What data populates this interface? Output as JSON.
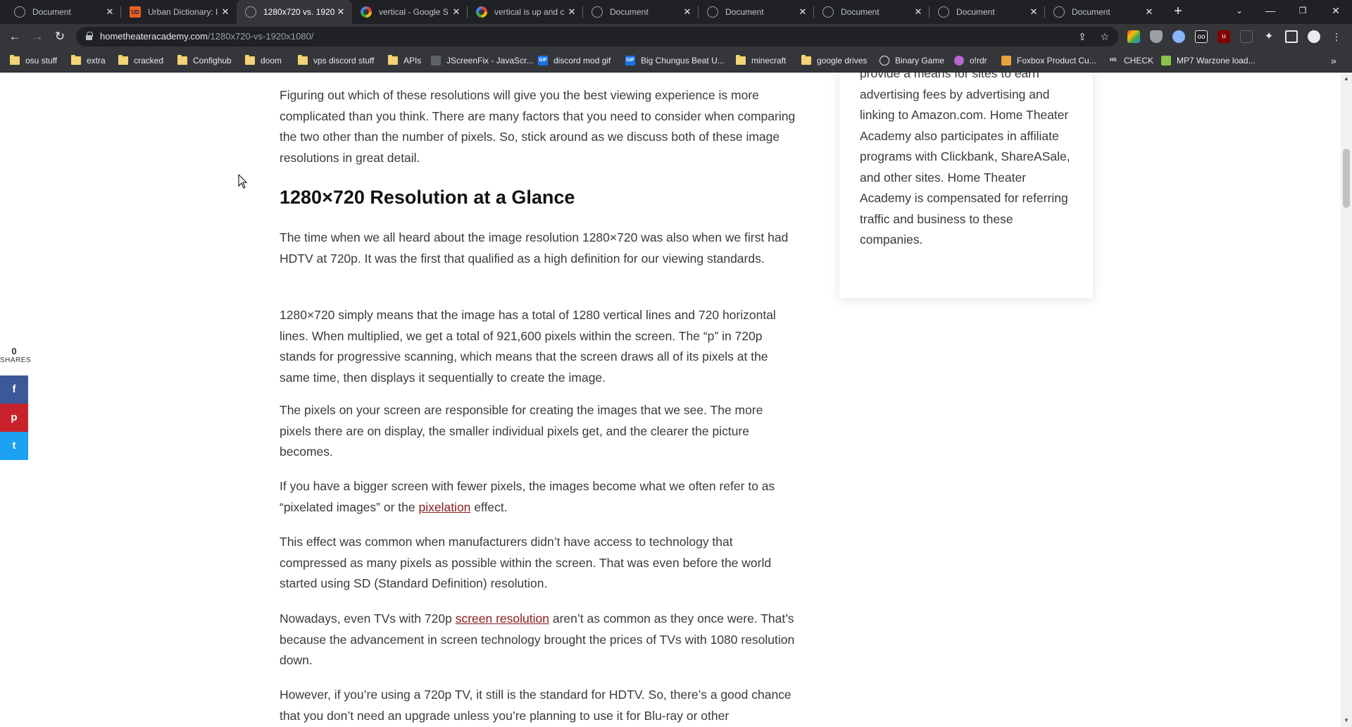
{
  "tabs": [
    {
      "title": "Document",
      "icon": "globe-icon",
      "active": false
    },
    {
      "title": "Urban Dictionary: I",
      "icon": "urban-dictionary-icon",
      "active": false
    },
    {
      "title": "1280x720 vs. 1920",
      "icon": "globe-icon",
      "active": true
    },
    {
      "title": "vertical - Google S",
      "icon": "google-icon",
      "active": false
    },
    {
      "title": "vertical is up and c",
      "icon": "google-icon",
      "active": false
    },
    {
      "title": "Document",
      "icon": "globe-icon",
      "active": false
    },
    {
      "title": "Document",
      "icon": "globe-icon",
      "active": false
    },
    {
      "title": "Document",
      "icon": "globe-icon",
      "active": false
    },
    {
      "title": "Document",
      "icon": "globe-icon",
      "active": false
    },
    {
      "title": "Document",
      "icon": "globe-icon",
      "active": false
    }
  ],
  "address": {
    "host": "hometheateracademy.com",
    "path": "/1280x720-vs-1920x1080/"
  },
  "bookmarks": [
    {
      "label": "osu stuff",
      "icon": "folder-icon"
    },
    {
      "label": "extra",
      "icon": "folder-icon"
    },
    {
      "label": "cracked",
      "icon": "folder-icon"
    },
    {
      "label": "Confighub",
      "icon": "folder-icon"
    },
    {
      "label": "doom",
      "icon": "folder-icon"
    },
    {
      "label": "vps discord stuff",
      "icon": "folder-icon"
    },
    {
      "label": "APIs",
      "icon": "folder-icon"
    },
    {
      "label": "JScreenFix - JavaScr...",
      "icon": "monitor-icon"
    },
    {
      "label": "discord mod gif",
      "icon": "gif-icon"
    },
    {
      "label": "Big Chungus Beat U...",
      "icon": "gif-icon"
    },
    {
      "label": "minecraft",
      "icon": "folder-icon"
    },
    {
      "label": "google drives",
      "icon": "folder-icon"
    },
    {
      "label": "Binary Game",
      "icon": "globe-icon"
    },
    {
      "label": "o!rdr",
      "icon": "ordr-icon"
    },
    {
      "label": "Foxbox Product Cu...",
      "icon": "box-icon"
    },
    {
      "label": "CHECK",
      "icon": "hs-icon"
    },
    {
      "label": "MP7 Warzone load...",
      "icon": "leaf-icon"
    }
  ],
  "article": {
    "p1": "Figuring out which of these resolutions will give you the best viewing experience is more complicated than you think. There are many factors that you need to consider when comparing the two other than the number of pixels. So, stick around as we discuss both of these image resolutions in great detail.",
    "h2": "1280×720 Resolution at a Glance",
    "p2": "The time when we all heard about the image resolution 1280×720 was also when we first had HDTV at 720p. It was the first that qualified as a high definition for our viewing standards.",
    "p3": "1280×720 simply means that the image has a total of 1280 vertical lines and 720 horizontal lines. When multiplied, we get a total of 921,600 pixels within the screen. The “p” in 720p stands for progressive scanning, which means that the screen draws all of its pixels at the same time, then displays it sequentially to create the image.",
    "p4": "The pixels on your screen are responsible for creating the images that we see. The more pixels there are on display, the smaller individual pixels get, and the clearer the picture becomes.",
    "p5_before": "If you have a bigger screen with fewer pixels, the images become what we often refer to as “pixelated images” or the ",
    "p5_link": "pixelation",
    "p5_after": " effect.",
    "p6": "This effect was common when manufacturers didn’t have access to technology that compressed as many pixels as possible within the screen. That was even before the world started using SD (Standard Definition) resolution.",
    "p7_before": "Nowadays, even TVs with 720p ",
    "p7_link": "screen resolution",
    "p7_after": " aren’t as common as they once were. That’s because the advancement in screen technology brought the prices of TVs with 1080 resolution down.",
    "p8": "However, if you’re using a 720p TV, it still is the standard for HDTV. So, there’s a good chance that you don’t need an upgrade unless you’re planning to use it for Blu-ray or other"
  },
  "sidebar": {
    "text": "provide a means for sites to earn advertising fees by advertising and linking to Amazon.com. Home Theater Academy also participates in affiliate programs with Clickbank, ShareASale, and other sites. Home Theater Academy is compensated for referring traffic and business to these companies."
  },
  "share": {
    "count": "0",
    "label": "SHARES",
    "facebook": "f",
    "pinterest": "p",
    "twitter": "t"
  },
  "colors": {
    "facebook": "#3b5998",
    "pinterest": "#c8232c",
    "twitter": "#1da1f2",
    "link": "#8a1c1c"
  }
}
